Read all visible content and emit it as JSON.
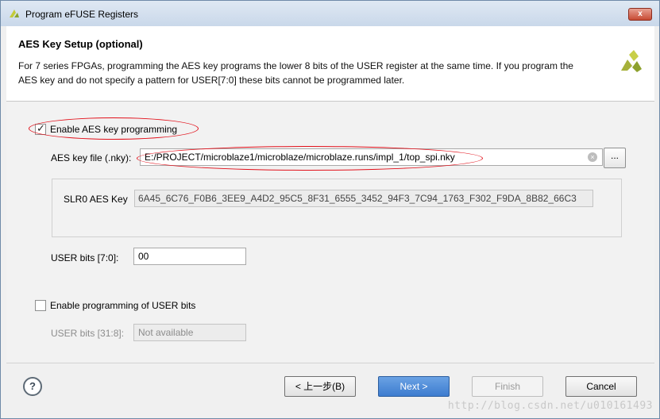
{
  "window": {
    "title": "Program eFUSE Registers",
    "close_label": "x"
  },
  "header": {
    "title": "AES Key Setup (optional)",
    "description": "For 7 series FPGAs, programming the AES key programs the lower 8 bits of the USER register at the same time. If you program the AES key and do not specify a pattern for USER[7:0] these bits cannot be programmed later."
  },
  "aes": {
    "enable_label": "Enable AES key programming",
    "enabled": true,
    "key_file_label": "AES key file (.nky):",
    "key_file_value": "E:/PROJECT/microblaze1/microblaze/microblaze.runs/impl_1/top_spi.nky",
    "browse_label": "...",
    "slr_label": "SLR0 AES Key",
    "slr_value": "6A45_6C76_F0B6_3EE9_A4D2_95C5_8F31_6555_3452_94F3_7C94_1763_F302_F9DA_8B82_66C3",
    "user_bits_label": "USER bits [7:0]:",
    "user_bits_value": "00"
  },
  "user_bits": {
    "enable_label": "Enable programming of USER bits",
    "enabled": false,
    "label": "USER bits [31:8]:",
    "value": "Not available"
  },
  "footer": {
    "help_label": "?",
    "back_label": "< 上一步(B)",
    "next_label": "Next >",
    "finish_label": "Finish",
    "cancel_label": "Cancel"
  },
  "watermark": "http://blog.csdn.net/u010161493",
  "colors": {
    "annotation": "#e2101a",
    "primary_button": "#3d7ccf"
  }
}
